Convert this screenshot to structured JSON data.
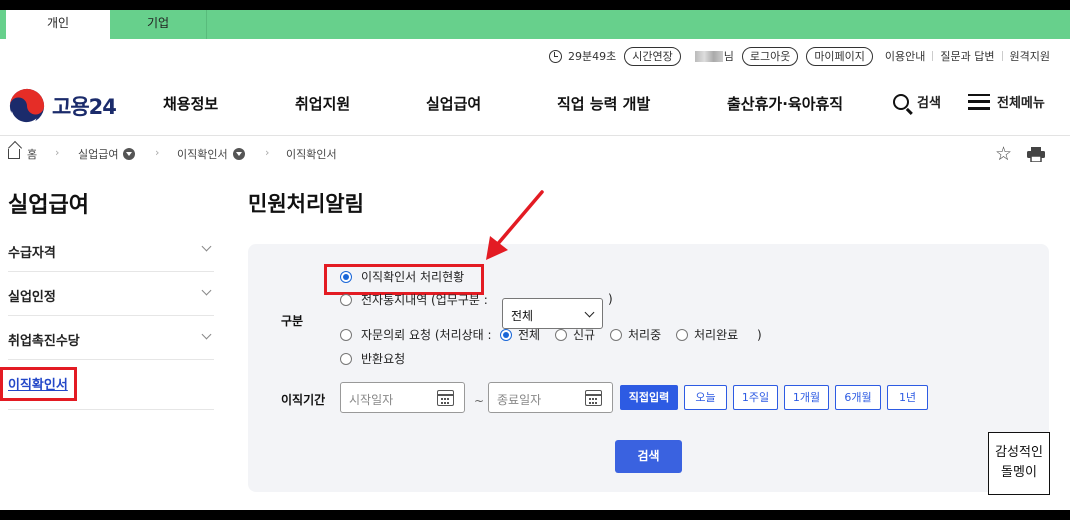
{
  "top_tabs": {
    "personal": "개인",
    "business": "기업"
  },
  "util": {
    "timer": "29분49초",
    "extend": "시간연장",
    "user_suffix": "님",
    "logout": "로그아웃",
    "mypage": "마이페이지",
    "links": [
      "이용안내",
      "질문과 답변",
      "원격지원"
    ]
  },
  "logo": {
    "text": "고용24"
  },
  "gnb": {
    "items": [
      "채용정보",
      "취업지원",
      "실업급여",
      "직업 능력 개발",
      "출산휴가·육아휴직"
    ],
    "search": "검색",
    "menu": "전체메뉴"
  },
  "breadcrumb": {
    "home": "홈",
    "level1": "실업급여",
    "level2": "이직확인서",
    "level3": "이직확인서"
  },
  "sidebar": {
    "title": "실업급여",
    "items": [
      {
        "label": "수급자격"
      },
      {
        "label": "실업인정"
      },
      {
        "label": "취업촉진수당"
      },
      {
        "label": "이직확인서"
      }
    ]
  },
  "main": {
    "title": "민원처리알림",
    "form": {
      "category_label": "구분",
      "options": {
        "opt1": "이직확인서 처리현황",
        "opt2": "전자통지내역 (업무구분 :",
        "opt2_select": "전체",
        "opt2_close": ")",
        "opt3": "자문의뢰 요청 (처리상태 :",
        "opt3_sub": [
          "전체",
          "신규",
          "처리중",
          "처리완료"
        ],
        "opt3_close": ")",
        "opt4": "반환요청"
      },
      "period_label": "이직기간",
      "start_placeholder": "시작일자",
      "end_placeholder": "종료일자",
      "tilde": "~",
      "direct_input": "직접입력",
      "periods": [
        "오늘",
        "1주일",
        "1개월",
        "6개월",
        "1년"
      ],
      "search_button": "검색"
    }
  },
  "watermark": {
    "line1": "감성적인",
    "line2": "돌멩이"
  },
  "colors": {
    "top_tab_green": "#67d08c",
    "primary_blue": "#2d5be3",
    "highlight_red": "#e31b23"
  }
}
